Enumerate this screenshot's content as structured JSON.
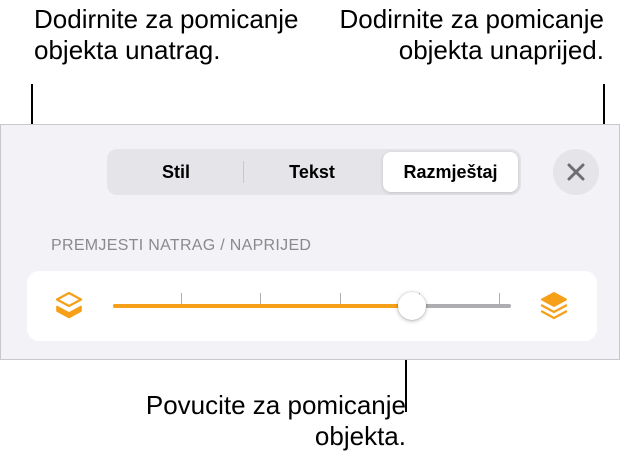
{
  "callouts": {
    "backward": "Dodirnite za pomicanje objekta unatrag.",
    "forward": "Dodirnite za pomicanje objekta unaprijed.",
    "drag": "Povucite za pomicanje objekta."
  },
  "tabs": [
    {
      "label": "Stil",
      "selected": false
    },
    {
      "label": "Tekst",
      "selected": false
    },
    {
      "label": "Razmještaj",
      "selected": true
    }
  ],
  "close_icon": "xmark-icon",
  "section_label": "PREMJESTI NATRAG / NAPRIJED",
  "slider": {
    "value_fraction": 0.75,
    "tick_count": 5,
    "left_icon": "send-backward-layers-icon",
    "right_icon": "bring-forward-layers-icon"
  },
  "colors": {
    "accent": "#f6a01a",
    "panel": "#f2f2f7",
    "track": "#aeaeb2"
  }
}
